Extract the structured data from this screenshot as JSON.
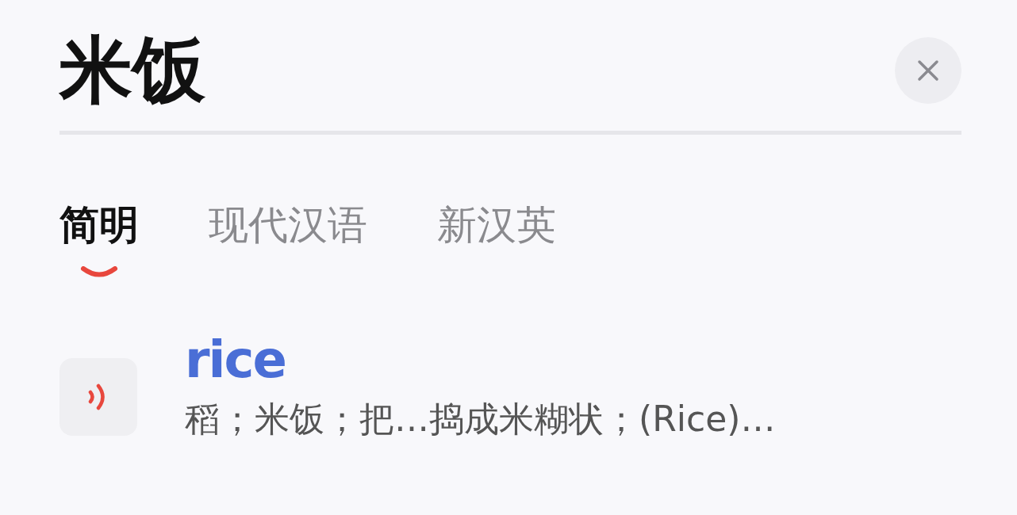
{
  "title": "米饭",
  "tabs": [
    {
      "label": "简明",
      "selected": true
    },
    {
      "label": "现代汉语",
      "selected": false
    },
    {
      "label": "新汉英",
      "selected": false
    }
  ],
  "entry": {
    "word": "rice",
    "definition": "稻；米饭；把…捣成米糊状；(Rice)…"
  }
}
